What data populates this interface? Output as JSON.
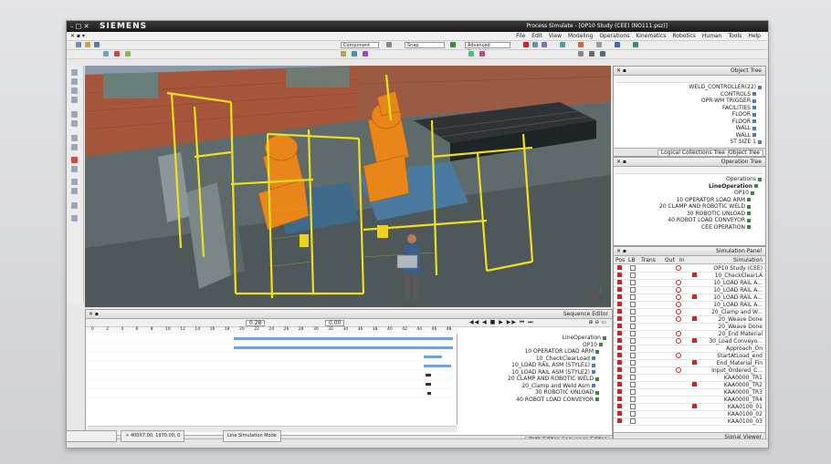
{
  "titlebar": {
    "brand": "SIEMENS",
    "title": "Process Simulate - [OP10 Study (CEE) (NO111.psz)]",
    "buttons": [
      "–",
      "□",
      "✕"
    ]
  },
  "menubar": {
    "items": [
      "File",
      "Edit",
      "View",
      "Modeling",
      "Operations",
      "Kinematics",
      "Robotics",
      "Human",
      "Tools",
      "Help"
    ],
    "left_controls": "✕ ▪ ▾"
  },
  "toolbar": {
    "component_combo": "Component",
    "snap_combo": "Snap",
    "sim_combo": "Advanced Simulation"
  },
  "object_tree": {
    "title": "Object Tree",
    "tabs": [
      "Object Tree",
      "Logical Collections Tree"
    ],
    "items": [
      "WELD_CONTROLLER(22)",
      "CONTROLS",
      "OPR-WM TRIGGER",
      "FACILITIES",
      "FLOOR",
      "FLOOR",
      "WALL",
      "WALL",
      "ST SIZE 1"
    ]
  },
  "operation_tree": {
    "title": "Operation Tree",
    "items": [
      "Operations",
      "LineOperation",
      "OP10",
      "10 OPERATOR LOAD ARM",
      "20 CLAMP AND ROBOTIC WELD",
      "30 ROBOTIC UNLOAD",
      "40 ROBOT LOAD CONVEYOR",
      "CEE OPERATION"
    ]
  },
  "simulation_panel": {
    "title": "Simulation Panel",
    "columns": [
      "Simulation",
      "In",
      "Out",
      "Trans",
      "LB",
      "Pos"
    ],
    "rows": [
      "OP10 Study (CEE)",
      "10_CheckClearLA",
      "10_LOAD RAIL A...",
      "10_LOAD RAIL A...",
      "10_LOAD RAIL A...",
      "10_LOAD RAIL A...",
      "20_Clamp and W...",
      "20_Weave Done",
      "20_Weave Done",
      "20_End Material",
      "30_Load Conveyo...",
      "Approach_On",
      "StartAtLoad_end",
      "End_Material_Fin",
      "Input_Ordered_C...",
      "KAA0000_TR1",
      "KAA0000_TR2",
      "KAA0000_TR3",
      "KAA0000_TR4",
      "KAA0100_01",
      "KAA0100_02",
      "KAA0100_03"
    ],
    "footer": "Signal Viewer"
  },
  "sequence_editor": {
    "title": "Sequence Editor",
    "time_current": "0.00",
    "time_end": "0.28",
    "tabs": [
      "Sequence Editor",
      "Path Editor"
    ],
    "items": [
      "LineOperation",
      "OP10",
      "10 OPERATOR LOAD ARM",
      "10_CheckClearLoad",
      "10_LOAD RAIL ASM (STYLE1)",
      "10_LOAD RAIL ASM (STYLE2)",
      "20 CLAMP AND ROBOTIC WELD",
      "20_Clamp and Weld Asm",
      "30 ROBOTIC UNLOAD",
      "40 ROBOT LOAD CONVEYOR"
    ],
    "ticks": [
      "0",
      "2",
      "4",
      "6",
      "8",
      "10",
      "12",
      "14",
      "16",
      "18",
      "20",
      "22",
      "24",
      "26",
      "28",
      "30",
      "32",
      "34",
      "36",
      "38",
      "40",
      "42",
      "44",
      "46",
      "48"
    ]
  },
  "taskbar": {
    "item1": "Line Simulation Mode",
    "item2": "400X7.00, 1970.00, 0"
  },
  "colors": {
    "fence": "#f0e01a",
    "robot": "#f08a1a",
    "sim_red": "#d42020"
  }
}
